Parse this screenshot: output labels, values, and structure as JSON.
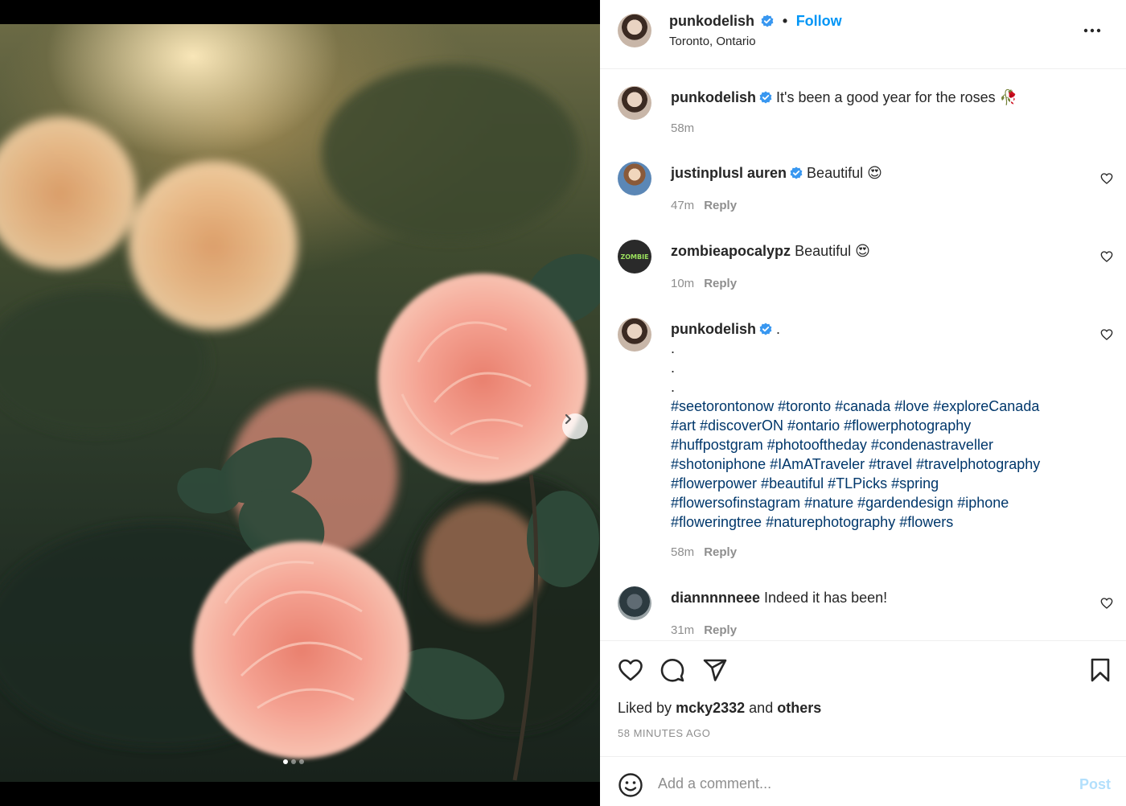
{
  "post": {
    "author": "punkodelish",
    "location": "Toronto, Ontario",
    "follow_label": "Follow",
    "separator": "•"
  },
  "caption": {
    "username": "punkodelish",
    "text": "It's been a good year for the roses",
    "emoji": "🥀",
    "time": "58m"
  },
  "comments": [
    {
      "username": "justinplusl auren",
      "text": "Beautiful",
      "emoji": "😍",
      "time": "47m",
      "reply": "Reply"
    },
    {
      "username": "zombieapocalypz",
      "text": "Beautiful",
      "emoji": "😍",
      "time": "10m",
      "reply": "Reply"
    },
    {
      "username": "punkodelish",
      "text": ".",
      "dots": [
        ".",
        ".",
        "."
      ],
      "hashtags": [
        "#seetorontonow #toronto #canada #love #exploreCanada",
        "#art #discoverON #ontario #flowerphotography",
        "#huffpostgram #photooftheday #condenastraveller",
        "#shotoniphone #IAmATraveler #travel #travelphotography",
        "#flowerpower #beautiful #TLPicks #spring",
        "#flowersofinstagram #nature #gardendesign #iphone",
        "#floweringtree #naturephotography #flowers"
      ],
      "time": "58m",
      "reply": "Reply"
    },
    {
      "username": "diannnnneee",
      "text": "Indeed it has been!",
      "time": "31m",
      "reply": "Reply"
    }
  ],
  "zombie_avatar_text": "ZOMBIE",
  "likes": {
    "prefix": "Liked by",
    "user": "mcky2332",
    "middle": "and",
    "others": "others"
  },
  "time_ago": "58 MINUTES AGO",
  "composer": {
    "placeholder": "Add a comment...",
    "post_label": "Post"
  },
  "carousel": {
    "count": 3,
    "active": 1
  },
  "colors": {
    "accent": "#0095f6",
    "verified": "#3897f0",
    "muted": "#8e8e8e",
    "post_disabled": "#b2dffc"
  }
}
